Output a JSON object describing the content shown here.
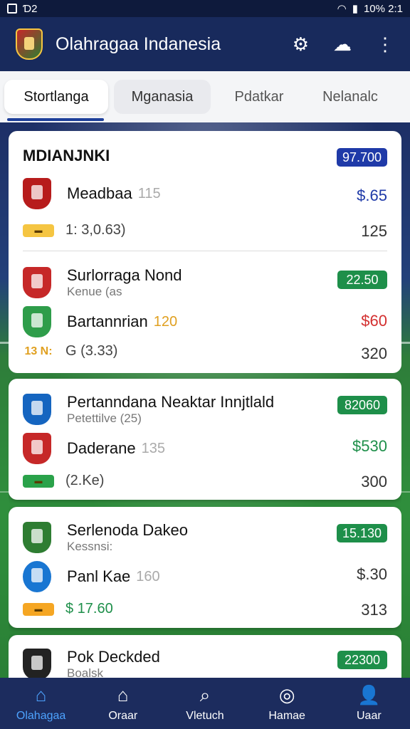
{
  "status": {
    "left_text": "Ɗ2",
    "right_text": "10% 2:1"
  },
  "app": {
    "title": "Olahragaa Indanesia"
  },
  "tabs": [
    {
      "label": "Stortlanga"
    },
    {
      "label": "Mganasia"
    },
    {
      "label": "Pdatkar"
    },
    {
      "label": "Nelanalc"
    }
  ],
  "cards": [
    {
      "title": "MDIANJNKI",
      "pill": "97.700",
      "pill_color": "#1f3aa8",
      "rows": [
        {
          "name": "Meadbaa",
          "minute": "115",
          "value": "$.65",
          "value_color": "#1f3aa8",
          "crest": "#b71c1c"
        }
      ],
      "tag_color": "#f5c542",
      "meta": "1: 3,0.63)",
      "meta_value": "125"
    },
    {
      "rows": [
        {
          "name": "Surlorraga Nond",
          "sub": "Kenue (as",
          "crest": "#c62828"
        },
        {
          "name": "Bartannrian",
          "minute": "120",
          "value": "$60",
          "value_color": "#d32f2f",
          "crest": "#2e9d4a"
        }
      ],
      "pill": "22.50",
      "pill_color": "#1e8f4a",
      "tag_text": "13 N:",
      "meta": "G (3.33)",
      "meta_value": "320"
    },
    {
      "rows": [
        {
          "name": "Pertanndana Neaktar Innjtlald",
          "sub": "Petettilve (25)",
          "crest": "#1565c0"
        },
        {
          "name": "Daderane",
          "minute": "135",
          "value": "$530",
          "value_color": "#1e8f4a",
          "crest": "#c62828"
        }
      ],
      "pill": "82060",
      "pill_color": "#1e8f4a",
      "tag_color": "#2aa24a",
      "meta": "(2.Ke)",
      "meta_value": "300"
    },
    {
      "rows": [
        {
          "name": "Serlenoda Dakeo",
          "sub": "Kessnsi:",
          "crest": "#2e7d32"
        },
        {
          "name": "Panl Kae",
          "minute": "160",
          "value": "$.30",
          "value_color": "#333",
          "crest": "#1976d2"
        }
      ],
      "pill": "15.130",
      "pill_color": "#1e8f4a",
      "tag_color": "#f5a623",
      "meta": "$ 17.60",
      "meta_value": "313"
    },
    {
      "rows": [
        {
          "name": "Pok Deckded",
          "sub": "Boalsk",
          "crest": "#222222"
        }
      ],
      "pill": "22300",
      "pill_color": "#1e8f4a"
    }
  ],
  "bottom_nav": [
    {
      "label": "Olahagaa",
      "icon": "home-icon",
      "glyph": "⌂"
    },
    {
      "label": "Oraar",
      "icon": "house-icon",
      "glyph": "⌂"
    },
    {
      "label": "Vletuch",
      "icon": "search-icon",
      "glyph": "⌕"
    },
    {
      "label": "Hamae",
      "icon": "target-icon",
      "glyph": "◎"
    },
    {
      "label": "Uaar",
      "icon": "user-icon",
      "glyph": "👤"
    }
  ]
}
